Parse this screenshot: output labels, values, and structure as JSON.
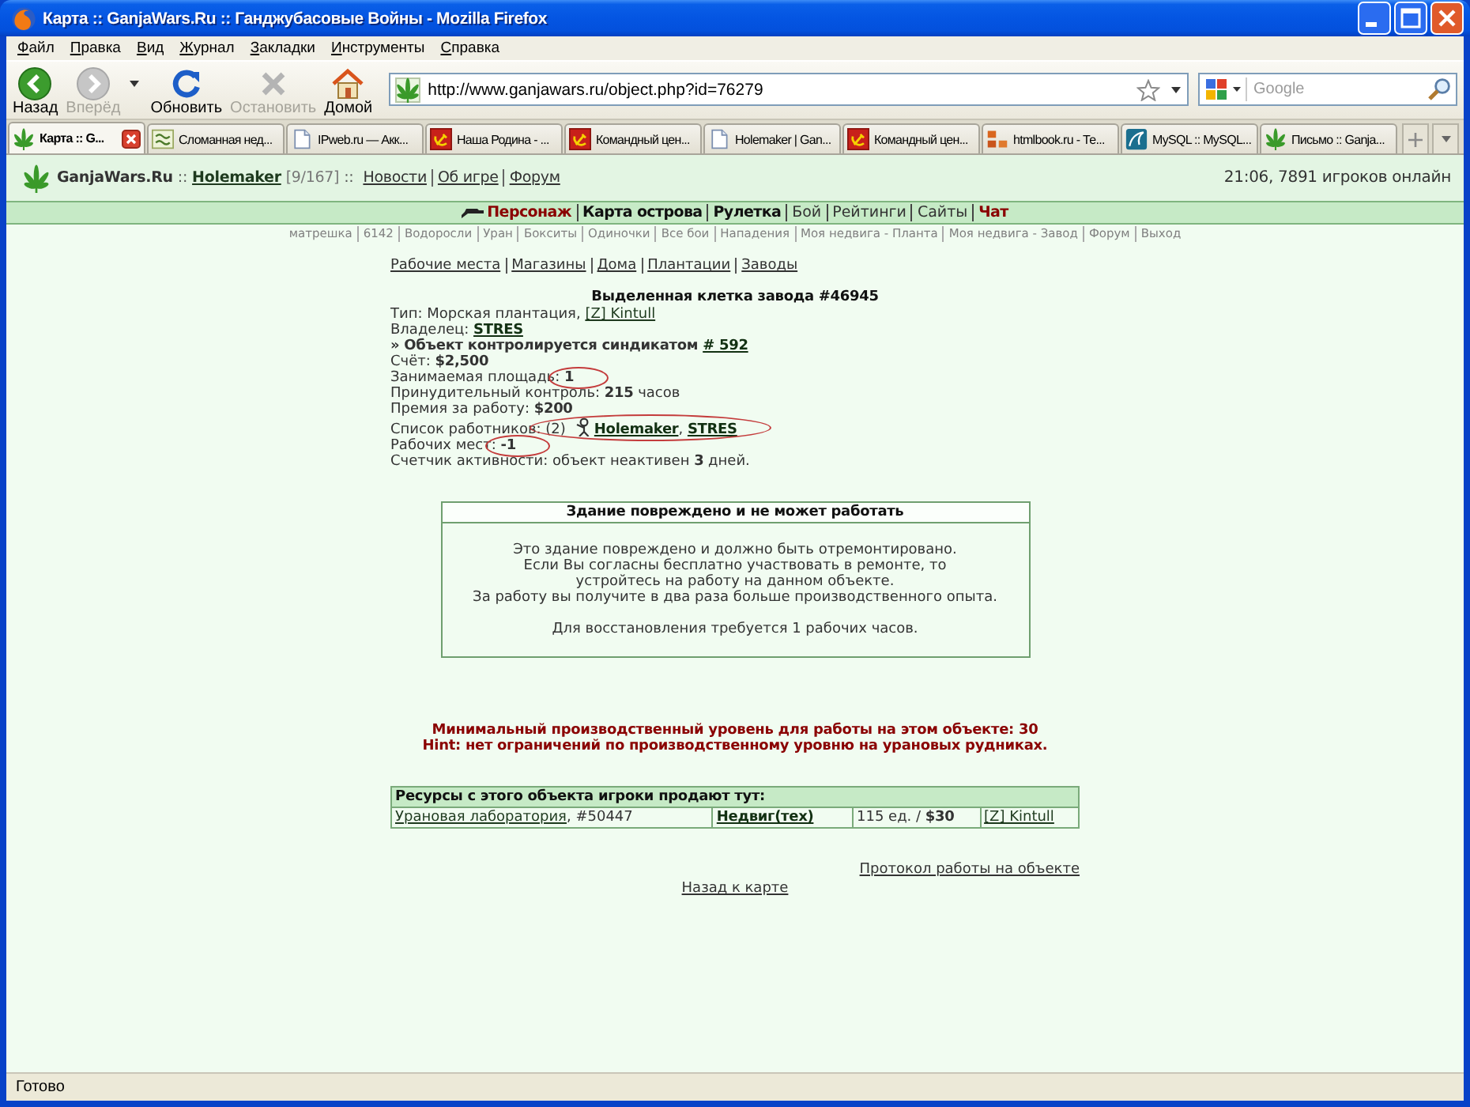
{
  "window": {
    "title": "Карта :: GanjaWars.Ru :: Ганджубасовые Войны - Mozilla Firefox"
  },
  "menu": [
    "Файл",
    "Правка",
    "Вид",
    "Журнал",
    "Закладки",
    "Инструменты",
    "Справка"
  ],
  "toolbar": {
    "buttons": [
      {
        "kind": "back",
        "label": "Назад",
        "disabled": false
      },
      {
        "kind": "forward",
        "label": "Вперёд",
        "disabled": true
      },
      {
        "kind": "reload",
        "label": "Обновить",
        "disabled": false
      },
      {
        "kind": "stop",
        "label": "Остановить",
        "disabled": true
      },
      {
        "kind": "home",
        "label": "Домой",
        "disabled": false
      }
    ],
    "address": "http://www.ganjawars.ru/object.php?id=76279",
    "search": {
      "placeholder": "Google"
    }
  },
  "tabs": [
    {
      "label": "Карта :: G...",
      "kind": "leaf",
      "selected": true
    },
    {
      "label": "Сломанная нед...",
      "kind": "tile",
      "selected": false
    },
    {
      "label": "IPweb.ru — Акк...",
      "kind": "page",
      "selected": false
    },
    {
      "label": "Наша Родина - ...",
      "kind": "emblem",
      "selected": false
    },
    {
      "label": "Командный цен...",
      "kind": "emblem",
      "selected": false
    },
    {
      "label": "Holemaker | Gan...",
      "kind": "page",
      "selected": false
    },
    {
      "label": "Командный цен...",
      "kind": "emblem",
      "selected": false
    },
    {
      "label": "htmlbook.ru - Те...",
      "kind": "blocks",
      "selected": false
    },
    {
      "label": "MySQL :: MySQL...",
      "kind": "wave",
      "selected": false
    },
    {
      "label": "Письмо :: Ganja...",
      "kind": "leaf",
      "selected": false
    }
  ],
  "header": {
    "items": [
      {
        "kind": "site",
        "text": "GanjaWars.Ru"
      },
      {
        "kind": "sep",
        "text": "::"
      },
      {
        "kind": "user",
        "text": "Holemaker"
      },
      {
        "kind": "stat",
        "text": "[9/167]"
      },
      {
        "kind": "sep",
        "text": "::"
      },
      {
        "kind": "link",
        "text": "Новости"
      },
      {
        "kind": "link",
        "text": "Об игре"
      },
      {
        "kind": "link",
        "text": "Форум"
      }
    ],
    "status": "21:06, 7891 игроков онлайн"
  },
  "nav": [
    {
      "label": "Персонаж",
      "kind": "alert",
      "icon": true
    },
    {
      "label": "Карта острова",
      "kind": "bold",
      "icon": false
    },
    {
      "label": "Рулетка",
      "kind": "bold",
      "icon": false
    },
    {
      "label": "Бой",
      "kind": "plain",
      "icon": false
    },
    {
      "label": "Рейтинги",
      "kind": "plain",
      "icon": false
    },
    {
      "label": "Сайты",
      "kind": "plain",
      "icon": false
    },
    {
      "label": "Чат",
      "kind": "alert",
      "icon": false
    }
  ],
  "subnav": [
    "матрешка",
    "6142",
    "Водоросли",
    "Уран",
    "Бокситы",
    "Одиночки",
    "Все бои",
    "Нападения",
    "Моя недвига - Планта",
    "Моя недвига - Завод",
    "Форум",
    "Выход"
  ],
  "sections": [
    "Рабочие места",
    "Магазины",
    "Дома",
    "Плантации",
    "Заводы"
  ],
  "object": {
    "title": "Выделенная клетка завода #46945",
    "lines": [
      {
        "circled": false,
        "parts": [
          {
            "kind": "text",
            "text": "Тип: Морская плантация, ",
            "bold": false
          },
          {
            "kind": "link",
            "text": "[Z] Kintull",
            "bold": false
          }
        ]
      },
      {
        "circled": false,
        "parts": [
          {
            "kind": "text",
            "text": "Владелец: ",
            "bold": false
          },
          {
            "kind": "link",
            "text": "STRES",
            "bold": true
          }
        ]
      },
      {
        "circled": false,
        "parts": [
          {
            "kind": "text",
            "text": "» Объект контролируется синдикатом ",
            "bold": true
          },
          {
            "kind": "link",
            "text": "# 592",
            "bold": true
          }
        ]
      },
      {
        "circled": false,
        "parts": [
          {
            "kind": "text",
            "text": "Счёт: **$2,500**",
            "bold": false
          }
        ]
      },
      {
        "circled": true,
        "parts": [
          {
            "kind": "text",
            "text": "Занимаемая площадь: ",
            "bold": false
          },
          {
            "kind": "text",
            "text": "1",
            "bold": true
          }
        ]
      },
      {
        "circled": false,
        "parts": [
          {
            "kind": "text",
            "text": "Принудительный контроль: **215** часов",
            "bold": false
          }
        ]
      },
      {
        "circled": false,
        "parts": [
          {
            "kind": "text",
            "text": "Премия за работу: **$200**",
            "bold": false
          }
        ]
      },
      {
        "circled": true,
        "parts": [
          {
            "kind": "text",
            "text": "Список работников: ",
            "bold": false
          },
          {
            "kind": "text",
            "text": "(2)",
            "bold": false
          },
          {
            "kind": "icon"
          },
          {
            "kind": "link",
            "text": "Holemaker",
            "bold": true
          },
          {
            "kind": "text",
            "text": ", ",
            "bold": false
          },
          {
            "kind": "link",
            "text": "STRES",
            "bold": true
          }
        ]
      },
      {
        "circled": true,
        "parts": [
          {
            "kind": "text",
            "text": "Рабочих мест: ",
            "bold": false
          },
          {
            "kind": "text",
            "text": "-1",
            "bold": true
          }
        ]
      },
      {
        "circled": false,
        "parts": [
          {
            "kind": "text",
            "text": "Счетчик активности: объект неактивен **3** дней.",
            "bold": false
          }
        ]
      }
    ]
  },
  "notice": {
    "title": "Здание повреждено и не может работать",
    "message": [
      "Это здание повреждено и должно быть отремонтировано.",
      "Если Вы согласны бесплатно участвовать в ремонте, то",
      "устройтесь на работу на данном объекте.",
      "За работу вы получите в два раза больше производственного опыта."
    ],
    "note": "Для восстановления требуется 1 рабочих часов."
  },
  "warnings": [
    "Минимальный производственный уровень для работы на этом объекте: 30",
    "Hint: нет ограничений по производственному уровню на урановых рудниках."
  ],
  "market": {
    "title": "Ресурсы с этого объекта игроки продают тут:",
    "rows": [
      {
        "cells": [
          [
            {
              "kind": "link",
              "text": "Урановая лаборатория",
              "bold": false
            },
            {
              "kind": "text",
              "text": ", #50447",
              "bold": false
            }
          ],
          [
            {
              "kind": "link",
              "text": "Недвиг(тех)",
              "bold": true
            }
          ],
          [
            {
              "kind": "text",
              "text": "115 ед. / **$30**",
              "bold": false
            }
          ],
          [
            {
              "kind": "link",
              "text": "[Z] Kintull",
              "bold": false
            }
          ]
        ]
      }
    ]
  },
  "footer": {
    "log_link": "Протокол работы на объекте",
    "back_link": "Назад к карте"
  },
  "status_bar": "Готово"
}
